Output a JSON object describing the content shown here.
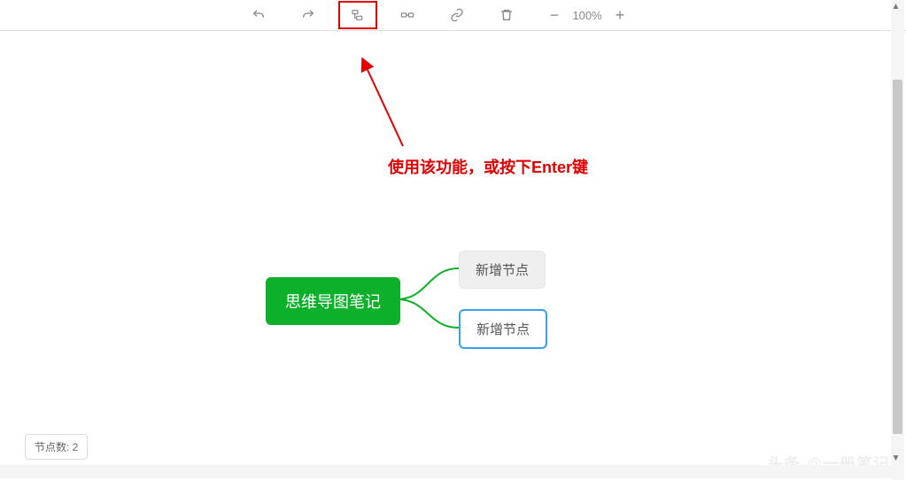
{
  "toolbar": {
    "zoom_label": "100%"
  },
  "annotation": {
    "text": "使用该功能，或按下Enter键"
  },
  "mindmap": {
    "root": "思维导图笔记",
    "children": [
      {
        "label": "新增节点"
      },
      {
        "label": "新增节点"
      }
    ]
  },
  "status": {
    "node_count_label": "节点数: 2"
  },
  "watermark": "头条 @一册笔记"
}
